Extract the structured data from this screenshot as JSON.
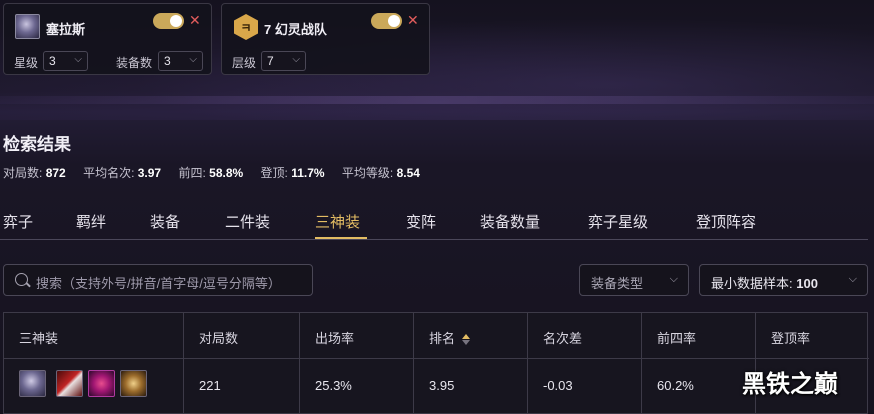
{
  "filters": {
    "unit": {
      "name": "塞拉斯",
      "star_label": "星级",
      "star_value": "3",
      "items_label": "装备数",
      "items_value": "3"
    },
    "trait": {
      "badge": "7",
      "name": "7 幻灵战队",
      "tier_label": "层级",
      "tier_value": "7"
    },
    "toggle_color": "#caa85a",
    "close_glyph": "✕"
  },
  "results": {
    "title": "检索结果",
    "stats": [
      {
        "label": "对局数:",
        "value": "872"
      },
      {
        "label": "平均名次:",
        "value": "3.97"
      },
      {
        "label": "前四:",
        "value": "58.8%"
      },
      {
        "label": "登顶:",
        "value": "11.7%"
      },
      {
        "label": "平均等级:",
        "value": "8.54"
      }
    ]
  },
  "tabs": [
    "弈子",
    "羁绊",
    "装备",
    "二件装",
    "三神装",
    "变阵",
    "装备数量",
    "弈子星级",
    "登顶阵容"
  ],
  "active_tab": "三神装",
  "accent_color": "#e3bc63",
  "search": {
    "placeholder": "搜索（支持外号/拼音/首字母/逗号分隔等）"
  },
  "dropdowns": {
    "item_type": "装备类型",
    "min_sample_label": "最小数据样本:",
    "min_sample_value": "100"
  },
  "table": {
    "headers": [
      "三神装",
      "对局数",
      "出场率",
      "排名",
      "名次差",
      "前四率",
      "登顶率"
    ],
    "sorted_column": "排名",
    "rows": [
      {
        "games": "221",
        "play_rate": "25.3%",
        "rank": "3.95",
        "diff": "-0.03",
        "top4": "60.2%",
        "win": ""
      }
    ]
  },
  "watermark": "黑铁之巅"
}
